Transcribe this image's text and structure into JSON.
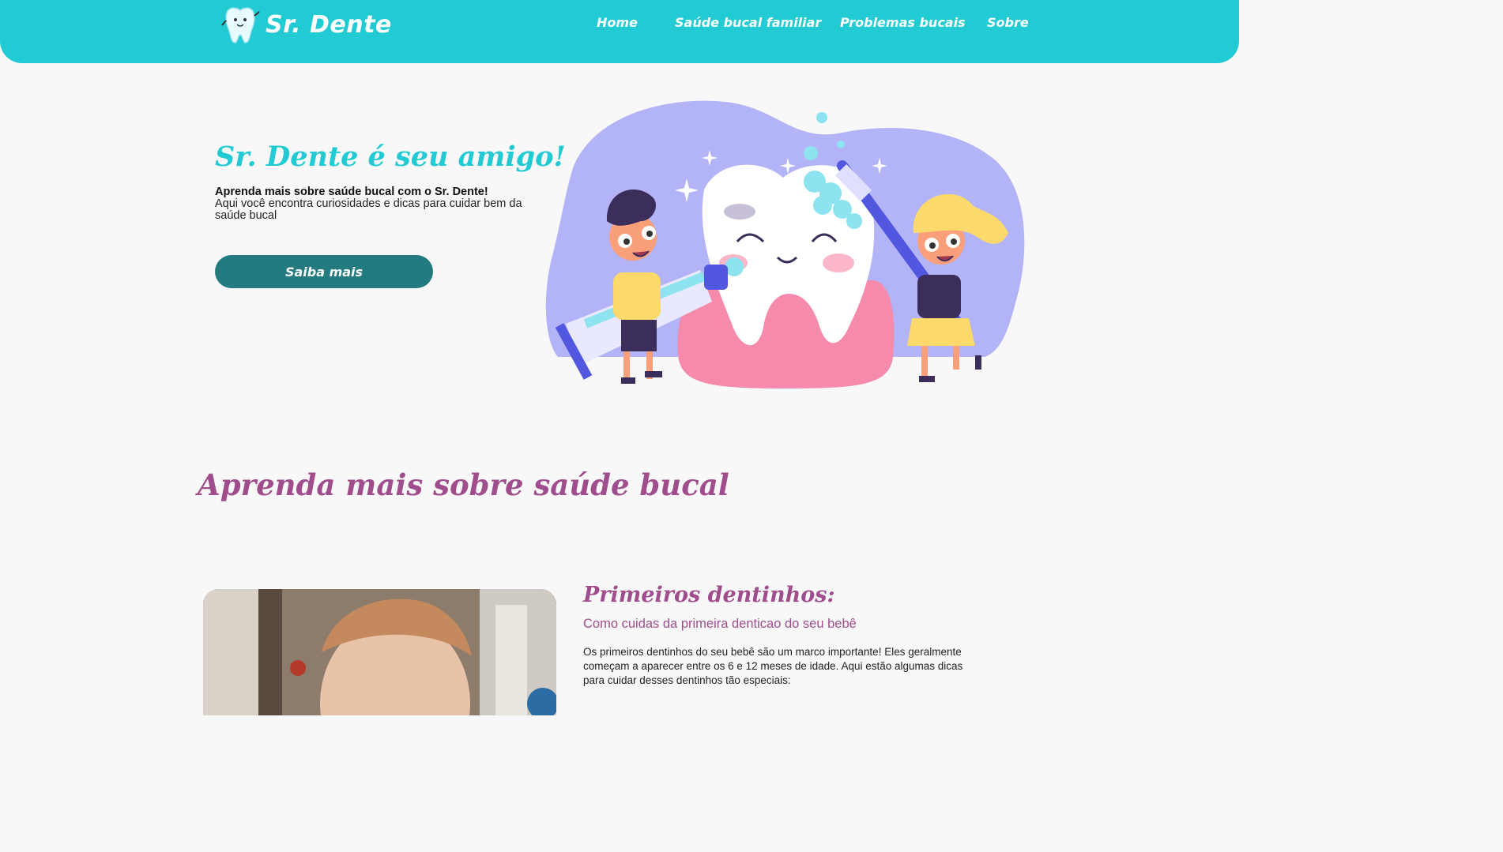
{
  "header": {
    "logo_text": "Sr. Dente",
    "nav": [
      "Home",
      "Saúde bucal familiar",
      "Problemas bucais",
      "Sobre"
    ]
  },
  "hero": {
    "title": "Sr. Dente é seu amigo!",
    "strong_text": "Aprenda mais sobre saúde bucal com o Sr. Dente!",
    "description": "Aqui você encontra curiosidades e dicas para cuidar bem da saúde bucal",
    "button_label": "Saiba mais"
  },
  "section": {
    "title": "Aprenda mais sobre saúde bucal"
  },
  "card": {
    "title": "Primeiros dentinhos:",
    "subtitle": "Como cuidas da primeira denticao do seu bebê",
    "text": "Os primeiros dentinhos do seu bebê são um marco importante! Eles geralmente começam a aparecer entre os 6 e 12 meses de idade. Aqui estão algumas dicas para cuidar desses dentinhos tão especiais:"
  },
  "colors": {
    "primary": "#22cad3",
    "button": "#237a7f",
    "accent": "#a04d8d",
    "background": "#f8f8f8",
    "illustration_blob": "#b3b3f7",
    "gum": "#f58aab"
  },
  "icons": {
    "logo": "tooth-mascot-icon"
  }
}
